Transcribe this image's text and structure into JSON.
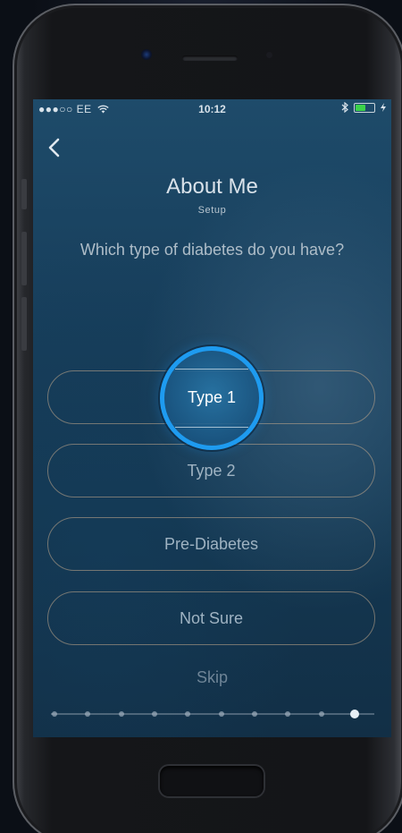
{
  "status_bar": {
    "carrier": "●●●○○ EE",
    "time": "10:12",
    "bluetooth_icon": "bluetooth-icon",
    "battery_level": 0.6,
    "battery_color": "#3bd34a"
  },
  "nav": {
    "back_icon": "chevron-left-icon"
  },
  "header": {
    "title": "About Me",
    "subtitle": "Setup"
  },
  "question": "Which type of diabetes do you have?",
  "options": [
    {
      "label": "Type 1",
      "selected": true
    },
    {
      "label": "Type 2",
      "selected": false
    },
    {
      "label": "Pre-Diabetes",
      "selected": false
    },
    {
      "label": "Not Sure",
      "selected": false
    }
  ],
  "skip_label": "Skip",
  "progress": {
    "total_steps": 10,
    "current_step": 10
  },
  "colors": {
    "highlight_ring": "#1e9bf0",
    "option_border": "#c4aa8c"
  }
}
